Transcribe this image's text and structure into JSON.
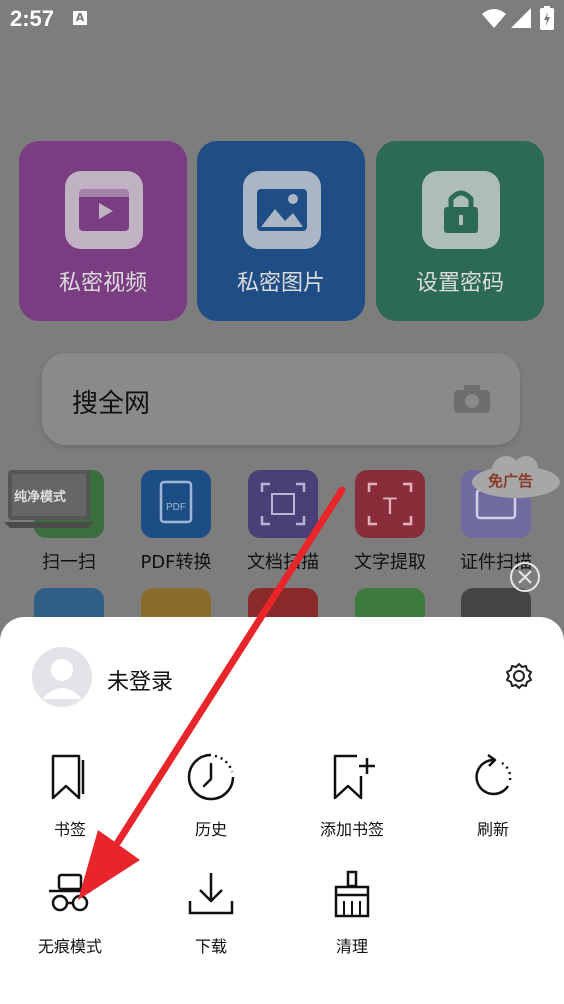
{
  "status": {
    "time": "2:57",
    "indicator": "A"
  },
  "tiles": [
    {
      "label": "私密视频",
      "color": "#7a3d82",
      "icon": "video-icon"
    },
    {
      "label": "私密图片",
      "color": "#1f4d85",
      "icon": "image-icon"
    },
    {
      "label": "设置密码",
      "color": "#2c6a55",
      "icon": "lock-icon"
    }
  ],
  "search": {
    "placeholder": "搜全网"
  },
  "badge": {
    "pure_mode": "纯净模式",
    "no_ads": "免广告"
  },
  "tools": [
    {
      "label": "扫一扫"
    },
    {
      "label": "PDF转换"
    },
    {
      "label": "文档扫描"
    },
    {
      "label": "文字提取"
    },
    {
      "label": "证件扫描"
    }
  ],
  "sheet": {
    "username": "未登录",
    "items": [
      {
        "label": "书签",
        "icon": "bookmark-icon"
      },
      {
        "label": "历史",
        "icon": "history-icon"
      },
      {
        "label": "添加书签",
        "icon": "add-bookmark-icon"
      },
      {
        "label": "刷新",
        "icon": "refresh-icon"
      },
      {
        "label": "无痕模式",
        "icon": "incognito-icon"
      },
      {
        "label": "下载",
        "icon": "download-icon"
      },
      {
        "label": "清理",
        "icon": "broom-icon"
      }
    ]
  },
  "colors": {
    "overlay": "#7d7d7d",
    "arrow": "#e8252b"
  }
}
